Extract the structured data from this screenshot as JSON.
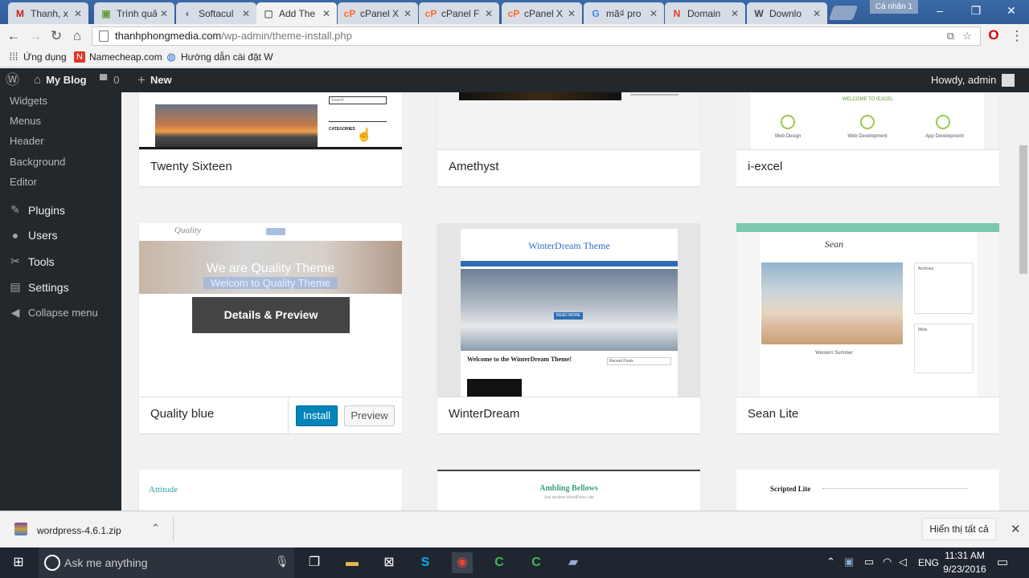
{
  "tabs": [
    {
      "title": "Thanh, x",
      "icon": "M",
      "color": "#c5221f",
      "icon_name": "gmail-icon"
    },
    {
      "title": "Trình quả",
      "icon": "▣",
      "color": "#6a9f3c",
      "icon_name": "app-icon"
    },
    {
      "title": "Softacul",
      "icon": "◐",
      "color": "#777",
      "icon_name": "softaculous-icon"
    },
    {
      "title": "Add The",
      "icon": "▢",
      "color": "#666",
      "icon_name": "page-icon"
    },
    {
      "title": "cPanel X",
      "icon": "cP",
      "color": "#ff6c2c",
      "icon_name": "cpanel-icon"
    },
    {
      "title": "cPanel F",
      "icon": "cP",
      "color": "#ff6c2c",
      "icon_name": "cpanel-icon"
    },
    {
      "title": "cPanel X",
      "icon": "cP",
      "color": "#ff6c2c",
      "icon_name": "cpanel-icon"
    },
    {
      "title": "mã₫ pro",
      "icon": "G",
      "color": "#4285f4",
      "icon_name": "google-icon"
    },
    {
      "title": "Domain",
      "icon": "N",
      "color": "#de3723",
      "icon_name": "namecheap-icon"
    },
    {
      "title": "Downlo",
      "icon": "W",
      "color": "#464646",
      "icon_name": "wordpress-icon"
    }
  ],
  "profile_label": "Cá nhân 1",
  "address": {
    "host": "thanhphongmedia.com",
    "path": "/wp-admin/theme-install.php"
  },
  "bookmarks": [
    {
      "label": "Ứng dụng",
      "icon": "apps-icon",
      "color": "#ea4335"
    },
    {
      "label": "Namecheap.com",
      "icon": "namecheap-icon",
      "color": "#de3723"
    },
    {
      "label": "Hướng dẫn cài đặt W",
      "icon": "globe-icon",
      "color": "#2a6fc9"
    }
  ],
  "adminbar": {
    "site": "My Blog",
    "comments": "0",
    "new": "New",
    "howdy": "Howdy, admin"
  },
  "sidebar": {
    "subitems": [
      "Widgets",
      "Menus",
      "Header",
      "Background",
      "Editor"
    ],
    "items": [
      {
        "label": "Plugins",
        "icon": "plugin-icon",
        "glyph": "✎"
      },
      {
        "label": "Users",
        "icon": "users-icon",
        "glyph": "●"
      },
      {
        "label": "Tools",
        "icon": "wrench-icon",
        "glyph": "✂"
      },
      {
        "label": "Settings",
        "icon": "settings-icon",
        "glyph": "▤"
      },
      {
        "label": "Collapse menu",
        "icon": "collapse-icon",
        "glyph": "◀"
      }
    ]
  },
  "themes": [
    {
      "name": "Twenty Sixteen",
      "sidebar_text": "Search",
      "sidebar_heading": "CATEGORIES"
    },
    {
      "name": "Amethyst"
    },
    {
      "name": "i-excel",
      "headline": "WELCOME TO IEXCEL",
      "features": [
        "Web Design",
        "Web Development",
        "App Development"
      ]
    },
    {
      "name": "Quality blue",
      "logo": "Quality",
      "hero1": "We are Quality Theme",
      "hero2": "Welcom to Quality Theme",
      "overlay": "Details & Preview",
      "install": "Install",
      "preview": "Preview"
    },
    {
      "name": "WinterDream",
      "title": "WinterDream Theme",
      "welcome": "Welcome to the WinterDream Theme!",
      "button": "READ MORE",
      "widget": "Recent Posts"
    },
    {
      "name": "Sean Lite",
      "logo": "Sean",
      "caption": "Western Summer",
      "widget1": "Archives",
      "widget2": "Meta"
    },
    {
      "name": "",
      "logo": "Attitude"
    },
    {
      "name": "",
      "logo": "Ambling Bellows",
      "tagline": "Just another WordPress site"
    },
    {
      "name": "",
      "logo": "Scripted Lite"
    }
  ],
  "download": {
    "file": "wordpress-4.6.1.zip",
    "show_all": "Hiển thị tất cả"
  },
  "taskbar": {
    "search": "Ask me anything",
    "lang": "ENG",
    "time": "11:31 AM",
    "date": "9/23/2016"
  },
  "colors": {
    "wp_dark": "#23282d",
    "wp_blue": "#0085ba",
    "chrome_tab_active": "#f2f2f2"
  }
}
